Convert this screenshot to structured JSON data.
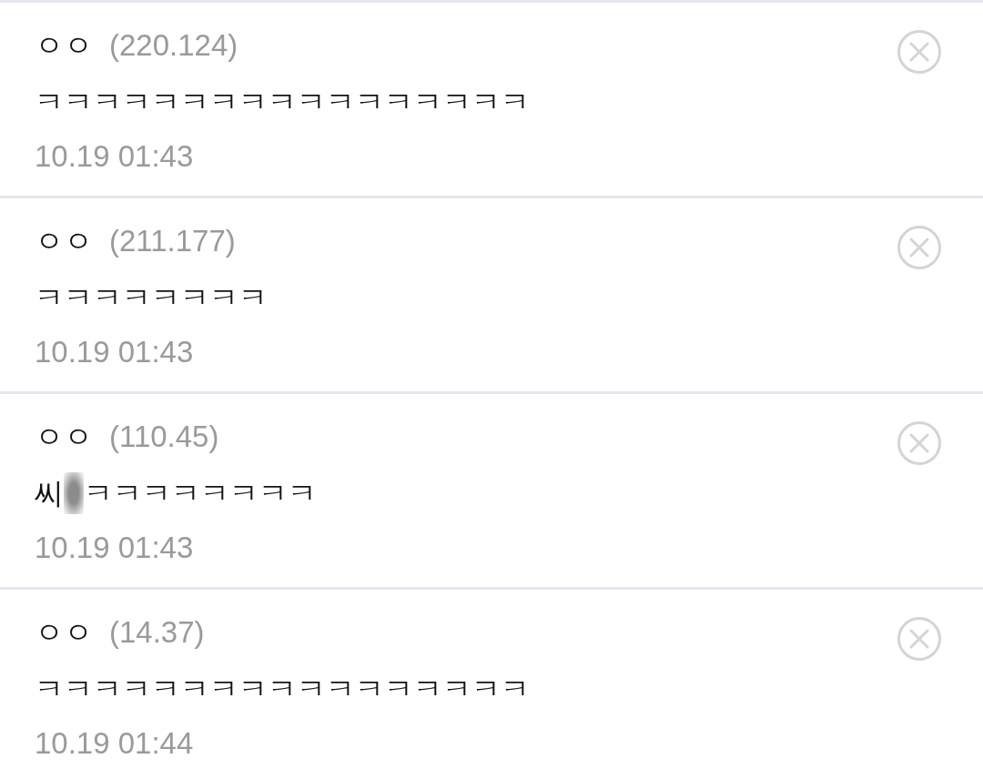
{
  "comments": [
    {
      "author": "ㅇㅇ",
      "ip": "(220.124)",
      "body": [
        {
          "kind": "text",
          "text": "ㅋㅋㅋㅋㅋㅋㅋㅋㅋㅋㅋㅋㅋㅋㅋㅋㅋ"
        }
      ],
      "time": "10.19 01:43"
    },
    {
      "author": "ㅇㅇ",
      "ip": "(211.177)",
      "body": [
        {
          "kind": "text",
          "text": "ㅋㅋㅋㅋㅋㅋㅋㅋ"
        }
      ],
      "time": "10.19 01:43"
    },
    {
      "author": "ㅇㅇ",
      "ip": "(110.45)",
      "body": [
        {
          "kind": "text",
          "text": "씨"
        },
        {
          "kind": "blur"
        },
        {
          "kind": "text",
          "text": "ㅋㅋㅋㅋㅋㅋㅋㅋ"
        }
      ],
      "time": "10.19 01:43"
    },
    {
      "author": "ㅇㅇ",
      "ip": "(14.37)",
      "body": [
        {
          "kind": "text",
          "text": "ㅋㅋㅋㅋㅋㅋㅋㅋㅋㅋㅋㅋㅋㅋㅋㅋㅋ"
        }
      ],
      "time": "10.19 01:44"
    }
  ]
}
